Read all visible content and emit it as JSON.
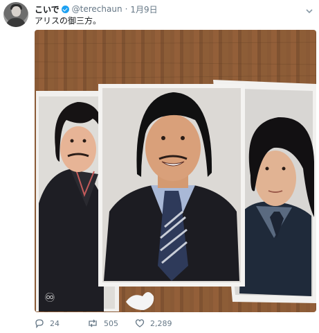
{
  "tweet": {
    "author_name": "こいで",
    "handle": "@terechaun",
    "separator": "·",
    "date": "1月9日",
    "text": "アリスの御三方。"
  },
  "icons": {
    "verified": "verified-badge-icon",
    "menu": "chevron-down-icon",
    "reply": "reply-icon",
    "retweet": "retweet-icon",
    "like": "heart-icon"
  },
  "actions": {
    "reply_count": "24",
    "retweet_count": "505",
    "like_count": "2,289"
  },
  "colors": {
    "verified": "#1da1f2",
    "muted": "#657786",
    "text": "#14171a"
  }
}
